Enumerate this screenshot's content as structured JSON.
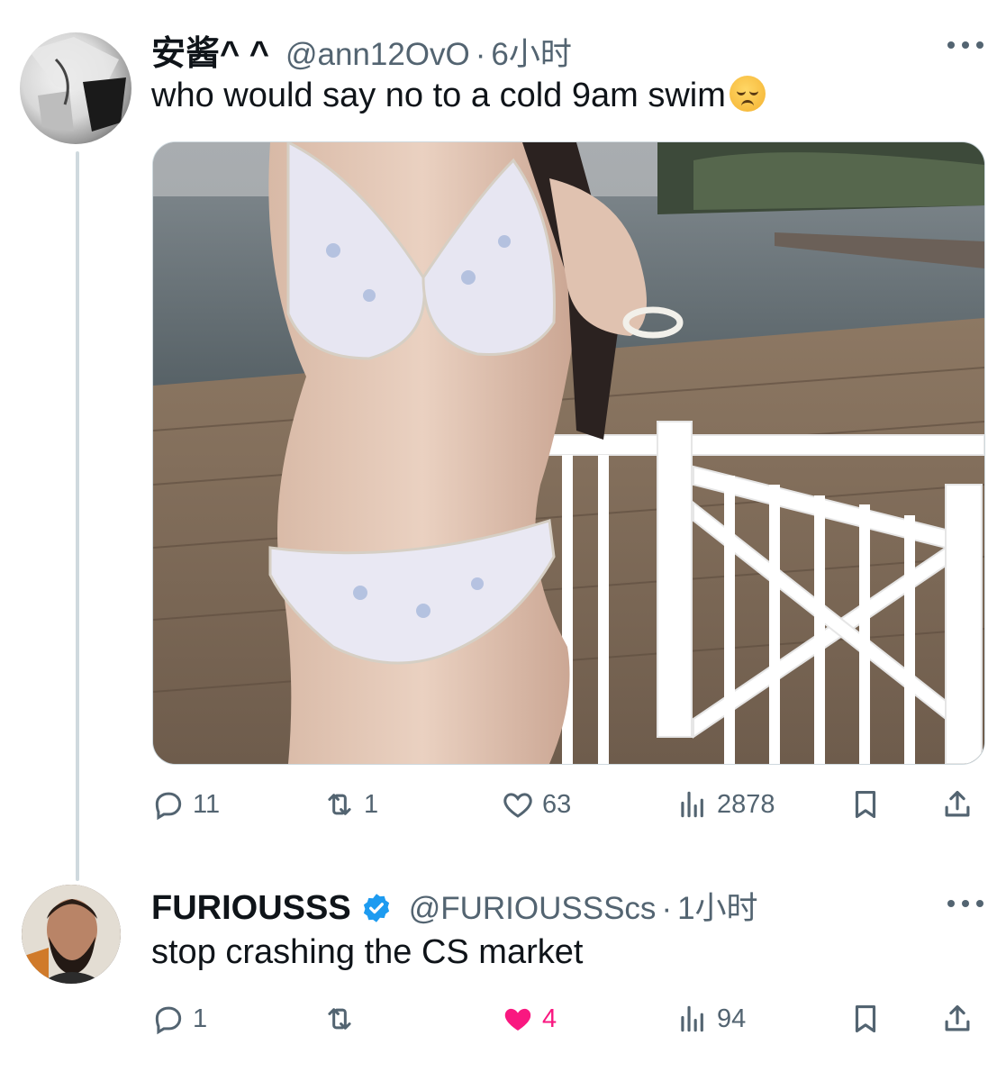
{
  "tweets": [
    {
      "author_name": "安酱^ ^",
      "handle": "@ann12OvO",
      "separator": "·",
      "time": "6小时",
      "text": "who would say no to a cold 9am swim",
      "emoji": "relieved-face",
      "counts": {
        "replies": "11",
        "retweets": "1",
        "likes": "63",
        "views": "2878"
      },
      "liked": false
    },
    {
      "author_name": "FURIOUSSS",
      "verified": true,
      "handle": "@FURIOUSSScs",
      "separator": "·",
      "time": "1小时",
      "text": "stop crashing the CS market",
      "counts": {
        "replies": "1",
        "retweets": "",
        "likes": "4",
        "views": "94"
      },
      "liked": true
    }
  ],
  "colors": {
    "text": "#0f1419",
    "secondary": "#536471",
    "verified": "#1d9bf0",
    "like": "#f91880",
    "thread_line": "#cfd9de"
  },
  "icons": [
    "reply-icon",
    "retweet-icon",
    "like-icon",
    "views-icon",
    "bookmark-icon",
    "share-icon",
    "more-icon",
    "verified-badge-icon"
  ]
}
